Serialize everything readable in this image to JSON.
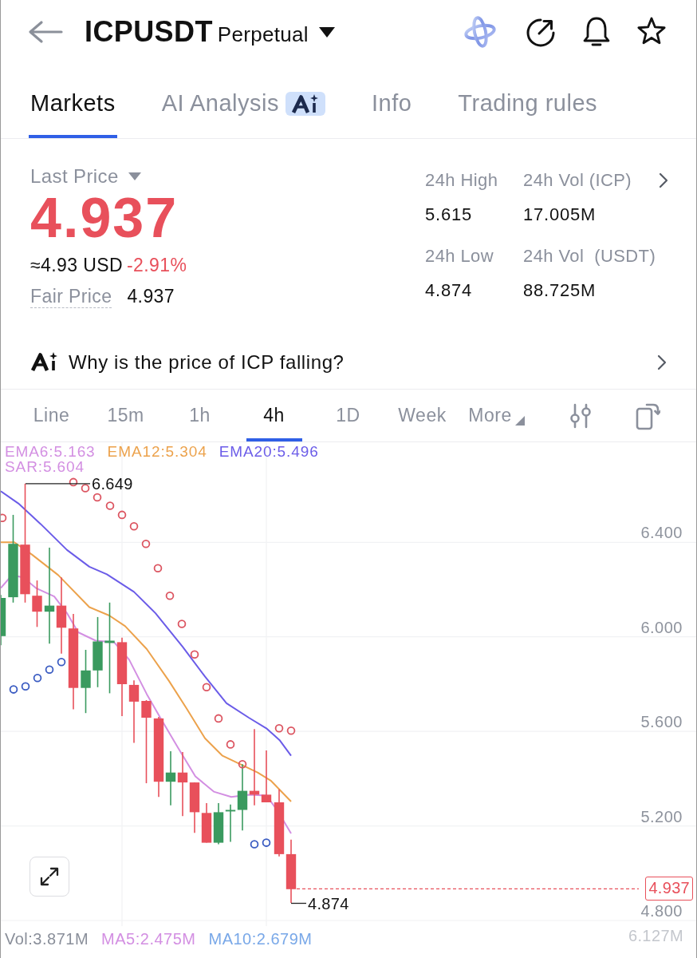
{
  "header": {
    "symbol": "ICPUSDT",
    "contract": "Perpetual"
  },
  "tabs": [
    {
      "label": "Markets",
      "kind": "plain",
      "selected": true
    },
    {
      "label": "AI Analysis",
      "kind": "ai",
      "selected": false
    },
    {
      "label": "Info",
      "kind": "plain",
      "selected": false
    },
    {
      "label": "Trading rules",
      "kind": "plain",
      "selected": false
    }
  ],
  "ticker": {
    "price_label": "Last Price",
    "last_price": "4.937",
    "approx_usd": "≈4.93 USD",
    "change": "-2.91%",
    "fair_price_label": "Fair Price",
    "fair_price": "4.937",
    "stats": [
      {
        "label": "24h High",
        "value": "5.615"
      },
      {
        "label": "24h Vol (ICP)",
        "value": "17.005M"
      },
      {
        "label": "24h Low",
        "value": "4.874"
      },
      {
        "label": "24h Vol  (USDT)",
        "value": "88.725M"
      }
    ]
  },
  "ai_prompt": {
    "text": "Why is the price of ICP falling?"
  },
  "intervals": [
    {
      "label": "Line",
      "selected": false,
      "menu": false
    },
    {
      "label": "15m",
      "selected": false,
      "menu": false
    },
    {
      "label": "1h",
      "selected": false,
      "menu": false
    },
    {
      "label": "4h",
      "selected": true,
      "menu": false
    },
    {
      "label": "1D",
      "selected": false,
      "menu": false
    },
    {
      "label": "Week",
      "selected": false,
      "menu": false
    },
    {
      "label": "More",
      "selected": false,
      "menu": true
    }
  ],
  "chart": {
    "indicators": [
      {
        "label": "EMA6:5.163",
        "color": "#d38fe2"
      },
      {
        "label": "EMA12:5.304",
        "color": "#eca24c"
      },
      {
        "label": "EMA20:5.496",
        "color": "#6b5ce8"
      },
      {
        "label": "SAR:5.604",
        "color": "#d38fe2"
      }
    ],
    "y_axis": [
      "6.400",
      "6.000",
      "5.600",
      "5.200",
      "4.800"
    ],
    "high_marker": "6.649",
    "low_marker": "4.874",
    "current_price": "4.937",
    "volume_legend": [
      {
        "label": "Vol:3.871M",
        "color": "#8a8f9a"
      },
      {
        "label": "MA5:2.475M",
        "color": "#d38fe2"
      },
      {
        "label": "MA10:2.679M",
        "color": "#79a8e8"
      }
    ],
    "volume_axis": "6.127M"
  }
}
